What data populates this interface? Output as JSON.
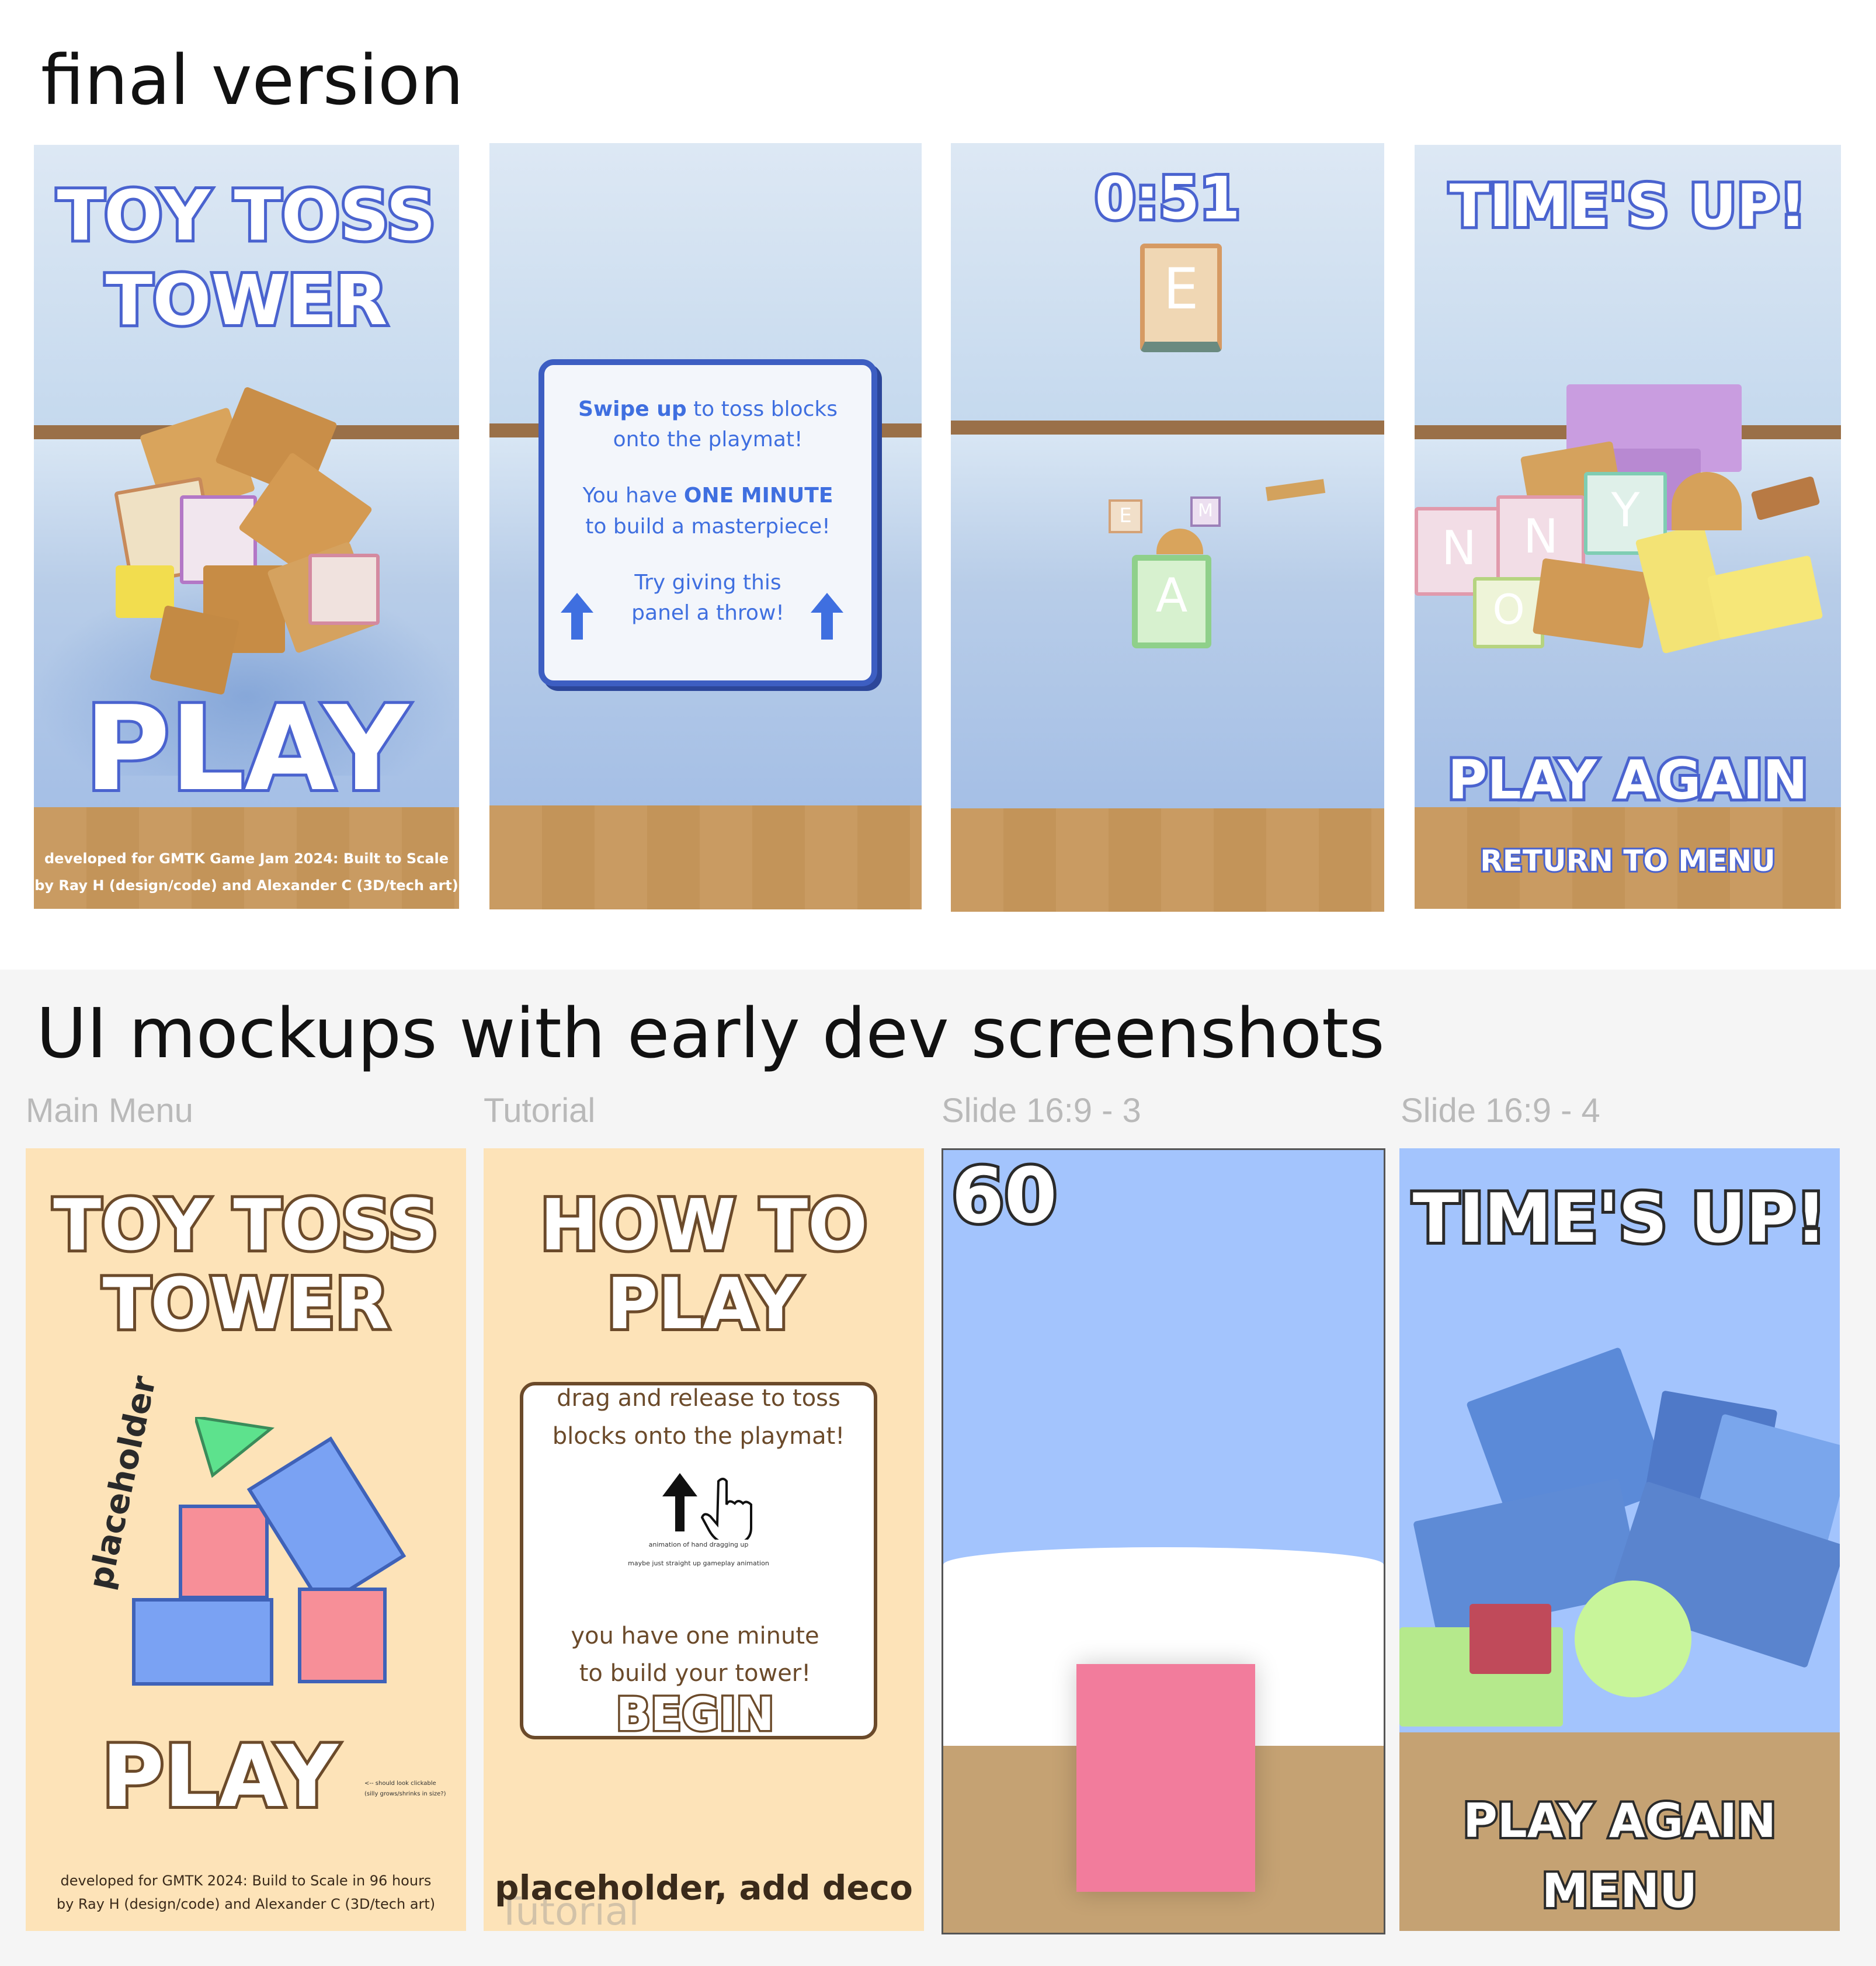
{
  "sections": {
    "final": {
      "title": "final version"
    },
    "mockups": {
      "title": "UI mockups with early dev screenshots"
    }
  },
  "final": {
    "panel1": {
      "title_line1": "TOY TOSS",
      "title_line2": "TOWER",
      "play": "PLAY",
      "credit_line1": "developed for GMTK Game Jam 2024: Built to Scale",
      "credit_line2": "by Ray H (design/code) and Alexander C (3D/tech art)"
    },
    "panel2": {
      "p1_bold": "Swipe up",
      "p1_rest": " to toss blocks",
      "p1_line2": "onto the playmat!",
      "p2_a": "You have ",
      "p2_bold": "ONE MINUTE",
      "p2_line2": "to build a masterpiece!",
      "p3_line1": "Try giving this",
      "p3_line2": "panel a throw!"
    },
    "panel3": {
      "timer": "0:51",
      "block_letter": "E",
      "block_letter_a": "A",
      "small_e": "E",
      "small_m": "M"
    },
    "panel4": {
      "title": "TIME'S UP!",
      "play_again": "PLAY AGAIN",
      "return": "RETURN TO MENU",
      "letters": [
        "N",
        "N",
        "Y",
        "O"
      ]
    }
  },
  "mockups": {
    "labels": [
      "Main Menu",
      "Tutorial",
      "Slide 16:9 - 3",
      "Slide 16:9 - 4"
    ],
    "main_menu": {
      "title_line1": "TOY TOSS",
      "title_line2": "TOWER",
      "placeholder": "placeholder",
      "play": "PLAY",
      "note_line1": "<-- should look clickable",
      "note_line2": "(silly grows/shrinks in size?)",
      "credit_line1": "developed for GMTK 2024: Build to Scale in 96 hours",
      "credit_line2": "by Ray H (design/code) and Alexander C (3D/tech art)"
    },
    "tutorial": {
      "title_line1": "HOW TO",
      "title_line2": "PLAY",
      "instr_line1": "drag and release to toss",
      "instr_line2": "blocks onto the playmat!",
      "anim_note1": "animation of hand dragging up",
      "anim_note2": "maybe just straight up gameplay animation",
      "minute_line1": "you have one minute",
      "minute_line2": "to build your tower!",
      "begin": "BEGIN",
      "footer": "placeholder, add deco",
      "ghost": "Tutorial"
    },
    "slide3": {
      "timer": "60"
    },
    "slide4": {
      "title": "TIME'S UP!",
      "play_again": "PLAY AGAIN",
      "menu": "MENU"
    }
  },
  "colors": {
    "blue_outline": "#4a63cf",
    "brown_outline": "#6b4a2a",
    "mock_cream": "#fde3b8",
    "mock_sky": "#a3c4fd",
    "mock_floor": "#c5a273",
    "arrow_blue": "#3f6fe0"
  }
}
